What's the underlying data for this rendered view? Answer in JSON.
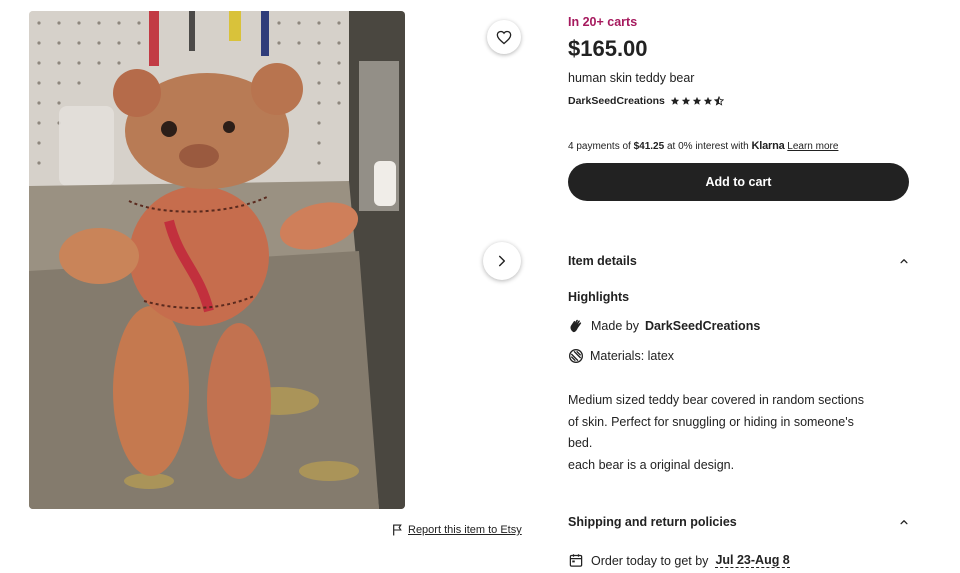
{
  "listing": {
    "carts_badge": "In 20+ carts",
    "price": "$165.00",
    "title": "human skin teddy bear",
    "shop_name": "DarkSeedCreations",
    "rating_stars": 4.5
  },
  "payments": {
    "prefix": "4 payments of",
    "amount": "$41.25",
    "middle": "at 0% interest with",
    "brand": "Klarna",
    "learn_more": "Learn more"
  },
  "actions": {
    "add_to_cart": "Add to cart",
    "report": "Report this item to Etsy"
  },
  "item_details": {
    "heading": "Item details",
    "highlights_heading": "Highlights",
    "made_by_prefix": "Made by",
    "made_by_shop": "DarkSeedCreations",
    "materials": "Materials: latex",
    "description": [
      "Medium sized teddy bear covered in random sections",
      "of skin. Perfect for snuggling or hiding in someone's",
      "bed.",
      "each bear is a original design."
    ]
  },
  "shipping": {
    "heading": "Shipping and return policies",
    "order_prefix": "Order today to get by",
    "date_range": "Jul 23-Aug 8"
  },
  "colors": {
    "carts_badge": "#a61a5e",
    "button_bg": "#222222"
  }
}
